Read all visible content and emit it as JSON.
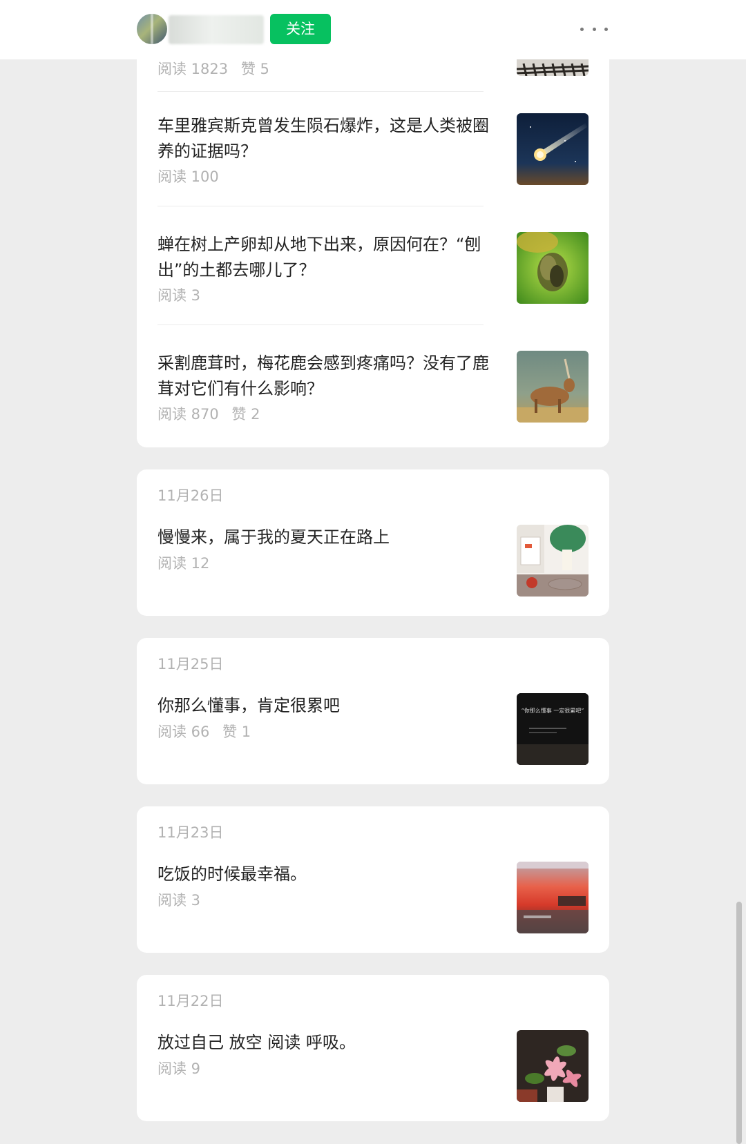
{
  "header": {
    "follow_label": "关注"
  },
  "colors": {
    "accent": "#07c160",
    "page_background": "#ededed",
    "meta_text": "#b2b2b2",
    "title_text": "#222222"
  },
  "top_card": {
    "partial_stats": {
      "reads": "阅读 1823",
      "likes": "赞 5"
    },
    "articles": [
      {
        "title": "车里雅宾斯克曾发生陨石爆炸，这是人类被圈养的证据吗？",
        "reads": "阅读 100",
        "likes": "",
        "thumb": "meteor-image"
      },
      {
        "title": "蝉在树上产卵却从地下出来，原因何在？“刨出”的土都去哪儿了？",
        "reads": "阅读 3",
        "likes": "",
        "thumb": "cicada-image"
      },
      {
        "title": "采割鹿茸时，梅花鹿会感到疼痛吗？没有了鹿茸对它们有什么影响？",
        "reads": "阅读 870",
        "likes": "赞 2",
        "thumb": "deer-image"
      }
    ]
  },
  "dated_cards": [
    {
      "date": "11月26日",
      "title": "慢慢来，属于我的夏天正在路上",
      "reads": "阅读 12",
      "likes": "",
      "thumb": "cafe-table-image"
    },
    {
      "date": "11月25日",
      "title": "你那么懂事，肯定很累吧",
      "reads": "阅读 66",
      "likes": "赞 1",
      "thumb": "dark-quote-image",
      "thumb_text": "“你那么懂事 一定很累吧”"
    },
    {
      "date": "11月23日",
      "title": "吃饭的时候最幸福。",
      "reads": "阅读 3",
      "likes": "",
      "thumb": "sunset-image"
    },
    {
      "date": "11月22日",
      "title": "放过自己 放空 阅读 呼吸。",
      "reads": "阅读 9",
      "likes": "",
      "thumb": "lily-flowers-image"
    }
  ]
}
